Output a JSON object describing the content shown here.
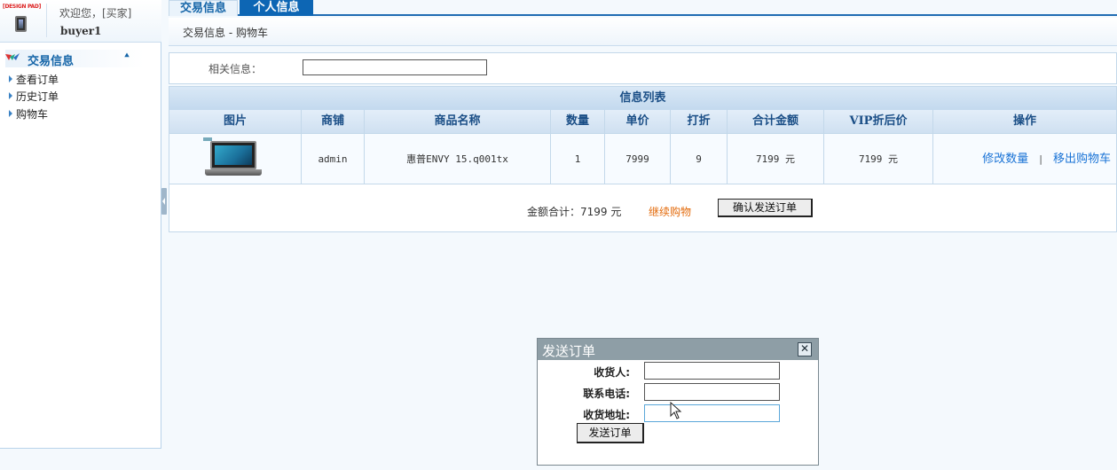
{
  "user": {
    "welcome": "欢迎您，[买家]",
    "name": "buyer1",
    "logo_text": "[DESIGN PAD]"
  },
  "sidebar": {
    "section_title": "交易信息",
    "collapse_icon": "double-chevron-up-icon",
    "items": [
      {
        "label": "查看订单"
      },
      {
        "label": "历史订单"
      },
      {
        "label": "购物车"
      }
    ]
  },
  "tabs": [
    {
      "label": "交易信息",
      "active": true
    },
    {
      "label": "个人信息",
      "active": false
    }
  ],
  "breadcrumb": "交易信息 - 购物车",
  "search": {
    "label": "相关信息：",
    "value": ""
  },
  "cart_table": {
    "caption": "信息列表",
    "columns": [
      "图片",
      "商铺",
      "商品名称",
      "数量",
      "单价",
      "打折",
      "合计金额",
      "VIP折后价",
      "操作"
    ],
    "rows": [
      {
        "image": "laptop-product-image",
        "shop": "admin",
        "product": "惠普ENVY 15.q001tx",
        "quantity": "1",
        "unit_price": "7999",
        "discount": "9",
        "total": "7199 元",
        "vip_price": "7199 元",
        "actions": [
          "修改数量",
          "|",
          "移出购物车"
        ]
      }
    ]
  },
  "summary": {
    "total_label": "金额合计：7199 元",
    "continue_label": "继续购物",
    "confirm_label": "确认发送订单"
  },
  "dialog": {
    "title": "发送订单",
    "close_icon": "close-icon",
    "fields": [
      {
        "label": "收货人:",
        "value": ""
      },
      {
        "label": "联系电话:",
        "value": ""
      },
      {
        "label": "收货地址:",
        "value": ""
      }
    ],
    "submit_label": "发送订单"
  },
  "colors": {
    "tab_active": "#0d66b4",
    "link": "#1a73d6",
    "continue_link": "#e36b0c",
    "dialog_title_bar": "#8e9ea6"
  }
}
